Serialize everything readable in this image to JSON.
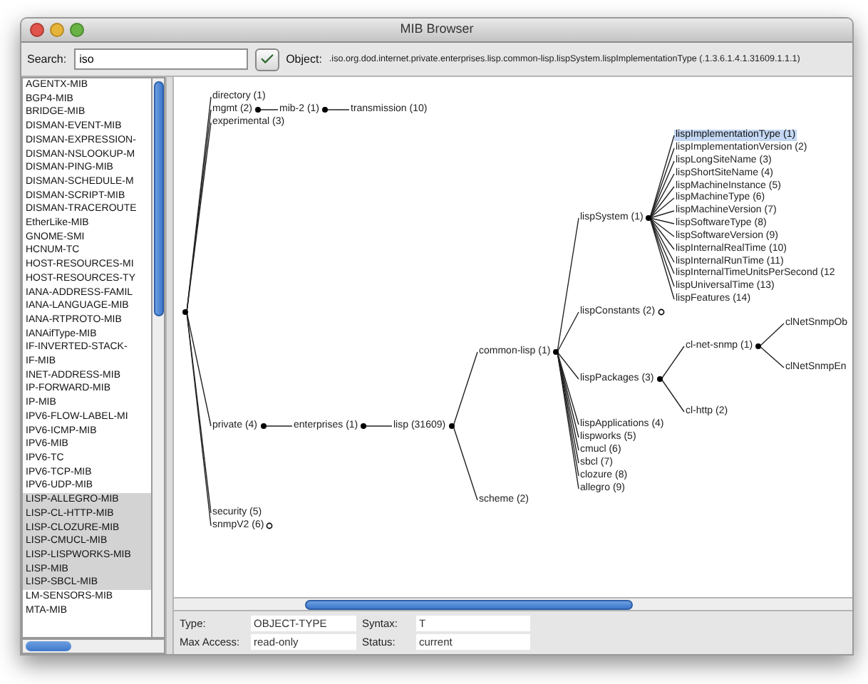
{
  "window": {
    "title": "MIB Browser"
  },
  "toolbar": {
    "search_label": "Search:",
    "search_value": "iso",
    "object_label": "Object:",
    "object_value": ".iso.org.dod.internet.private.enterprises.lisp.common-lisp.lispSystem.lispImplementationType (.1.3.6.1.4.1.31609.1.1.1)"
  },
  "modules": [
    {
      "label": "AGENTX-MIB",
      "selected": false
    },
    {
      "label": "BGP4-MIB",
      "selected": false
    },
    {
      "label": "BRIDGE-MIB",
      "selected": false
    },
    {
      "label": "DISMAN-EVENT-MIB",
      "selected": false
    },
    {
      "label": "DISMAN-EXPRESSION-",
      "selected": false
    },
    {
      "label": "DISMAN-NSLOOKUP-M",
      "selected": false
    },
    {
      "label": "DISMAN-PING-MIB",
      "selected": false
    },
    {
      "label": "DISMAN-SCHEDULE-M",
      "selected": false
    },
    {
      "label": "DISMAN-SCRIPT-MIB",
      "selected": false
    },
    {
      "label": "DISMAN-TRACEROUTE",
      "selected": false
    },
    {
      "label": "EtherLike-MIB",
      "selected": false
    },
    {
      "label": "GNOME-SMI",
      "selected": false
    },
    {
      "label": "HCNUM-TC",
      "selected": false
    },
    {
      "label": "HOST-RESOURCES-MI",
      "selected": false
    },
    {
      "label": "HOST-RESOURCES-TY",
      "selected": false
    },
    {
      "label": "IANA-ADDRESS-FAMIL",
      "selected": false
    },
    {
      "label": "IANA-LANGUAGE-MIB",
      "selected": false
    },
    {
      "label": "IANA-RTPROTO-MIB",
      "selected": false
    },
    {
      "label": "IANAifType-MIB",
      "selected": false
    },
    {
      "label": "IF-INVERTED-STACK-",
      "selected": false
    },
    {
      "label": "IF-MIB",
      "selected": false
    },
    {
      "label": "INET-ADDRESS-MIB",
      "selected": false
    },
    {
      "label": "IP-FORWARD-MIB",
      "selected": false
    },
    {
      "label": "IP-MIB",
      "selected": false
    },
    {
      "label": "IPV6-FLOW-LABEL-MI",
      "selected": false
    },
    {
      "label": "IPV6-ICMP-MIB",
      "selected": false
    },
    {
      "label": "IPV6-MIB",
      "selected": false
    },
    {
      "label": "IPV6-TC",
      "selected": false
    },
    {
      "label": "IPV6-TCP-MIB",
      "selected": false
    },
    {
      "label": "IPV6-UDP-MIB",
      "selected": false
    },
    {
      "label": "LISP-ALLEGRO-MIB",
      "selected": true
    },
    {
      "label": "LISP-CL-HTTP-MIB",
      "selected": true
    },
    {
      "label": "LISP-CLOZURE-MIB",
      "selected": true
    },
    {
      "label": "LISP-CMUCL-MIB",
      "selected": true
    },
    {
      "label": "LISP-LISPWORKS-MIB",
      "selected": true
    },
    {
      "label": "LISP-MIB",
      "selected": true
    },
    {
      "label": "LISP-SBCL-MIB",
      "selected": true
    },
    {
      "label": "LM-SENSORS-MIB",
      "selected": false
    },
    {
      "label": "MTA-MIB",
      "selected": false
    }
  ],
  "tree": {
    "kind": "open",
    "children": [
      {
        "label": "directory (1)",
        "kind": "leaf",
        "selected": false
      },
      {
        "label": "mgmt (2)",
        "kind": "open",
        "selected": false,
        "children": [
          {
            "label": "mib-2 (1)",
            "kind": "open",
            "selected": false,
            "children": [
              {
                "label": "transmission (10)",
                "kind": "leaf",
                "selected": false
              }
            ]
          }
        ]
      },
      {
        "label": "experimental (3)",
        "kind": "leaf",
        "selected": false
      },
      {
        "label": "private (4)",
        "kind": "open",
        "selected": false,
        "children": [
          {
            "label": "enterprises (1)",
            "kind": "open",
            "selected": false,
            "children": [
              {
                "label": "lisp (31609)",
                "kind": "open",
                "selected": false,
                "children": [
                  {
                    "label": "common-lisp (1)",
                    "kind": "open",
                    "selected": false,
                    "children": [
                      {
                        "label": "lispSystem (1)",
                        "kind": "open",
                        "selected": false,
                        "children": [
                          {
                            "label": "lispImplementationType (1)",
                            "kind": "leaf",
                            "selected": true
                          },
                          {
                            "label": "lispImplementationVersion (2)",
                            "kind": "leaf",
                            "selected": false
                          },
                          {
                            "label": "lispLongSiteName (3)",
                            "kind": "leaf",
                            "selected": false
                          },
                          {
                            "label": "lispShortSiteName (4)",
                            "kind": "leaf",
                            "selected": false
                          },
                          {
                            "label": "lispMachineInstance (5)",
                            "kind": "leaf",
                            "selected": false
                          },
                          {
                            "label": "lispMachineType (6)",
                            "kind": "leaf",
                            "selected": false
                          },
                          {
                            "label": "lispMachineVersion (7)",
                            "kind": "leaf",
                            "selected": false
                          },
                          {
                            "label": "lispSoftwareType (8)",
                            "kind": "leaf",
                            "selected": false
                          },
                          {
                            "label": "lispSoftwareVersion (9)",
                            "kind": "leaf",
                            "selected": false
                          },
                          {
                            "label": "lispInternalRealTime (10)",
                            "kind": "leaf",
                            "selected": false
                          },
                          {
                            "label": "lispInternalRunTime (11)",
                            "kind": "leaf",
                            "selected": false
                          },
                          {
                            "label": "lispInternalTimeUnitsPerSecond (12",
                            "kind": "leaf",
                            "selected": false
                          },
                          {
                            "label": "lispUniversalTime (13)",
                            "kind": "leaf",
                            "selected": false
                          },
                          {
                            "label": "lispFeatures (14)",
                            "kind": "leaf",
                            "selected": false
                          }
                        ]
                      },
                      {
                        "label": "lispConstants (2)",
                        "kind": "closed",
                        "selected": false
                      },
                      {
                        "label": "lispPackages (3)",
                        "kind": "open",
                        "selected": false,
                        "children": [
                          {
                            "label": "cl-net-snmp (1)",
                            "kind": "open",
                            "selected": false,
                            "children": [
                              {
                                "label": "clNetSnmpOb",
                                "selected": false
                              },
                              {
                                "label": "clNetSnmpEn",
                                "selected": false
                              }
                            ]
                          },
                          {
                            "label": "cl-http (2)",
                            "kind": "leaf",
                            "selected": false
                          }
                        ]
                      },
                      {
                        "label": "lispApplications (4)",
                        "kind": "leaf",
                        "selected": false
                      },
                      {
                        "label": "lispworks (5)",
                        "kind": "leaf",
                        "selected": false
                      },
                      {
                        "label": "cmucl (6)",
                        "kind": "leaf",
                        "selected": false
                      },
                      {
                        "label": "sbcl (7)",
                        "kind": "leaf",
                        "selected": false
                      },
                      {
                        "label": "clozure (8)",
                        "kind": "leaf",
                        "selected": false
                      },
                      {
                        "label": "allegro (9)",
                        "kind": "leaf",
                        "selected": false
                      }
                    ]
                  },
                  {
                    "label": "scheme (2)",
                    "kind": "leaf",
                    "selected": false
                  }
                ]
              }
            ]
          }
        ]
      },
      {
        "label": "security (5)",
        "kind": "leaf",
        "selected": false
      },
      {
        "label": "snmpV2 (6)",
        "kind": "closed",
        "selected": false
      }
    ]
  },
  "details": [
    {
      "label": "Type:",
      "value": "OBJECT-TYPE"
    },
    {
      "label": "Syntax:",
      "value": "T"
    },
    {
      "label": "Max Access:",
      "value": "read-only"
    },
    {
      "label": "Status:",
      "value": "current"
    }
  ]
}
